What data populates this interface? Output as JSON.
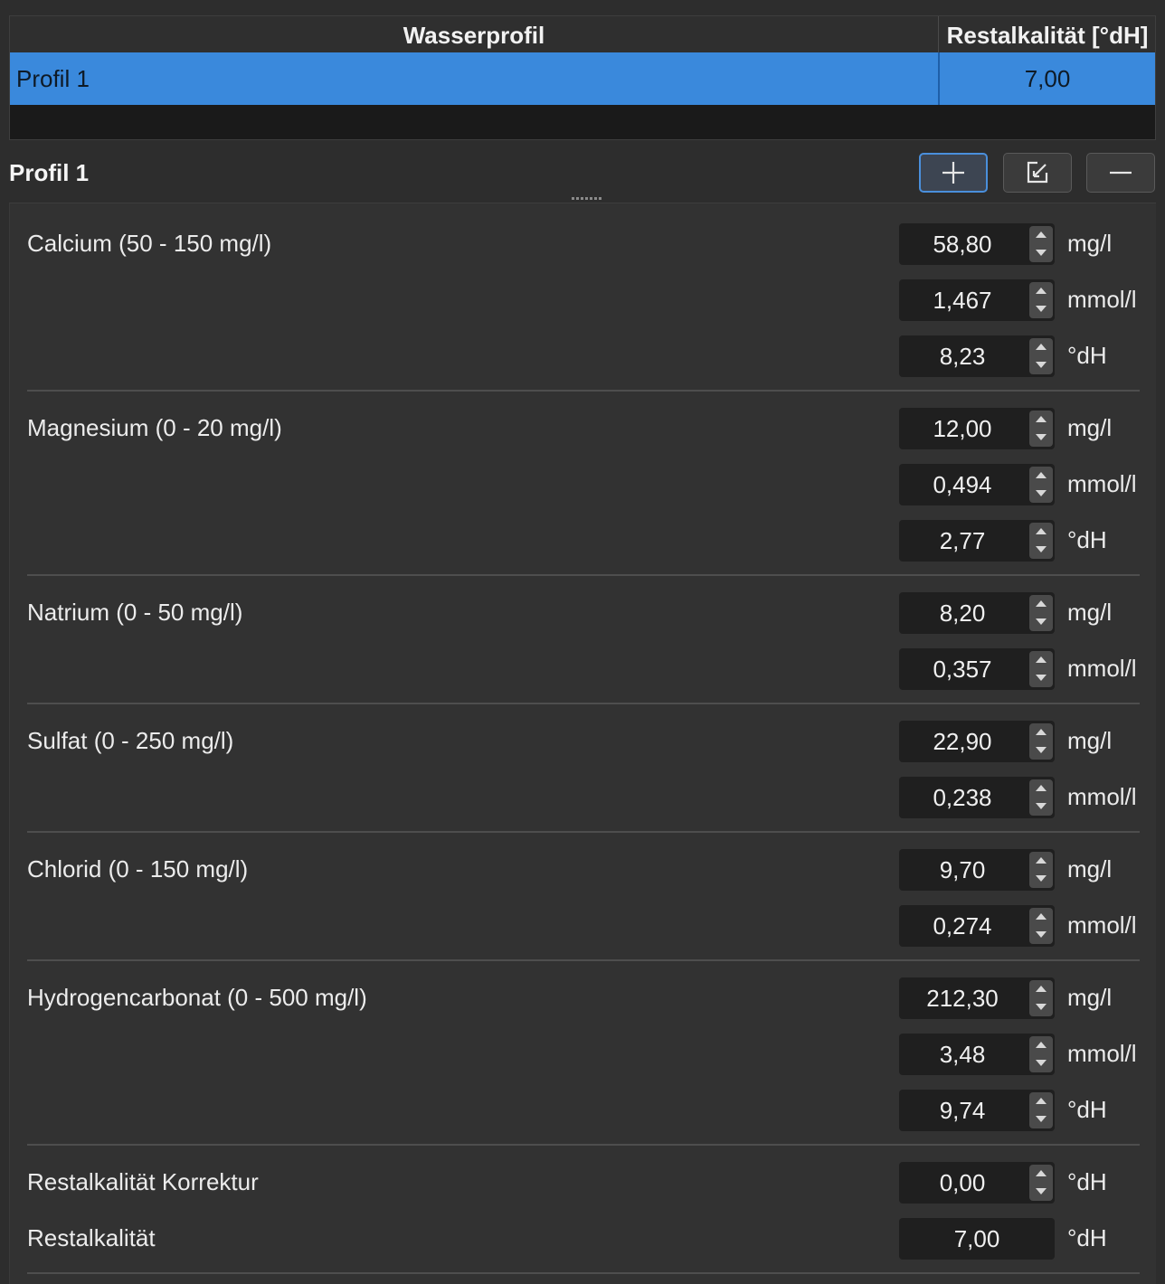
{
  "table": {
    "headers": [
      "Wasserprofil",
      "Restalkalität [°dH]"
    ],
    "rows": [
      [
        "Profil 1",
        "7,00"
      ]
    ]
  },
  "section": {
    "title": "Profil 1"
  },
  "toolbar": {
    "add_icon": "plus-icon",
    "edit_icon": "edit-icon",
    "remove_icon": "minus-icon"
  },
  "ions": [
    {
      "label": "Calcium (50 - 150 mg/l)",
      "fields": [
        {
          "value": "58,80",
          "unit": "mg/l"
        },
        {
          "value": "1,467",
          "unit": "mmol/l"
        },
        {
          "value": "8,23",
          "unit": "°dH"
        }
      ]
    },
    {
      "label": "Magnesium (0 - 20 mg/l)",
      "fields": [
        {
          "value": "12,00",
          "unit": "mg/l"
        },
        {
          "value": "0,494",
          "unit": "mmol/l"
        },
        {
          "value": "2,77",
          "unit": "°dH"
        }
      ]
    },
    {
      "label": "Natrium (0 - 50 mg/l)",
      "fields": [
        {
          "value": "8,20",
          "unit": "mg/l"
        },
        {
          "value": "0,357",
          "unit": "mmol/l"
        }
      ]
    },
    {
      "label": "Sulfat (0 - 250 mg/l)",
      "fields": [
        {
          "value": "22,90",
          "unit": "mg/l"
        },
        {
          "value": "0,238",
          "unit": "mmol/l"
        }
      ]
    },
    {
      "label": "Chlorid (0 - 150 mg/l)",
      "fields": [
        {
          "value": "9,70",
          "unit": "mg/l"
        },
        {
          "value": "0,274",
          "unit": "mmol/l"
        }
      ]
    },
    {
      "label": "Hydrogencarbonat (0 - 500 mg/l)",
      "fields": [
        {
          "value": "212,30",
          "unit": "mg/l"
        },
        {
          "value": "3,48",
          "unit": "mmol/l"
        },
        {
          "value": "9,74",
          "unit": "°dH"
        }
      ]
    }
  ],
  "correction": {
    "label": "Restalkalität Korrektur",
    "value": "0,00",
    "unit": "°dH"
  },
  "result": {
    "label": "Restalkalität",
    "value": "7,00",
    "unit": "°dH"
  }
}
